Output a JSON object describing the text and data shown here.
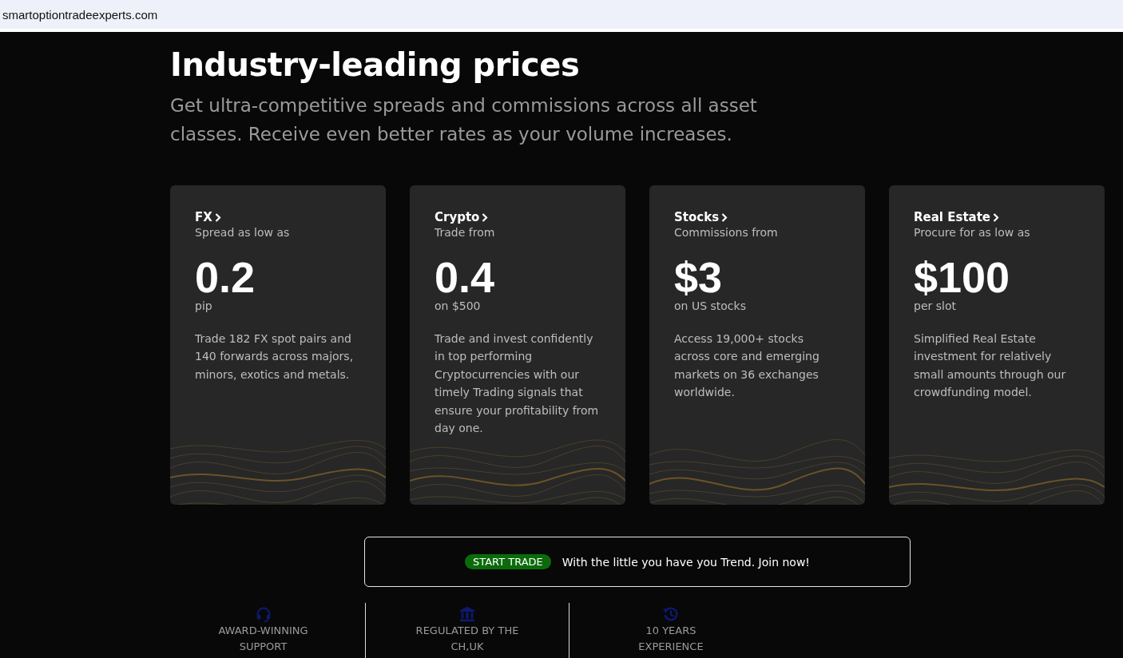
{
  "address_bar": {
    "url": "smartoptiontradeexperts.com"
  },
  "hero": {
    "title": "Industry-leading prices",
    "subtitle": "Get ultra-competitive spreads and commissions across all asset classes. Receive even better rates as your volume increases."
  },
  "cards": [
    {
      "title": "FX",
      "caption": "Spread as low as",
      "price": "0.2",
      "unit": "pip",
      "description": "Trade 182 FX spot pairs and 140 forwards across majors, minors, exotics and metals."
    },
    {
      "title": "Crypto",
      "caption": "Trade from",
      "price": "0.4",
      "unit": "on $500",
      "description": "Trade and invest confidently in top performing Cryptocurrencies with our timely Trading signals that ensure your profitability from day one."
    },
    {
      "title": "Stocks",
      "caption": "Commissions from",
      "price": "$3",
      "unit": "on US stocks",
      "description": "Access 19,000+ stocks across core and emerging markets on 36 exchanges worldwide."
    },
    {
      "title": "Real Estate",
      "caption": "Procure for as low as",
      "price": "$100",
      "unit": "per slot",
      "description": "Simplified Real Estate investment for relatively small amounts through our crowdfunding model."
    }
  ],
  "banner": {
    "button": "START TRADE",
    "text": "With the little you have you Trend. Join now!"
  },
  "features": [
    {
      "kind": "support",
      "label": "AWARD-WINNING SUPPORT"
    },
    {
      "kind": "regulated",
      "label": "REGULATED BY THE CH,UK"
    },
    {
      "kind": "experience",
      "label": "10 YEARS EXPERIENCE"
    }
  ]
}
